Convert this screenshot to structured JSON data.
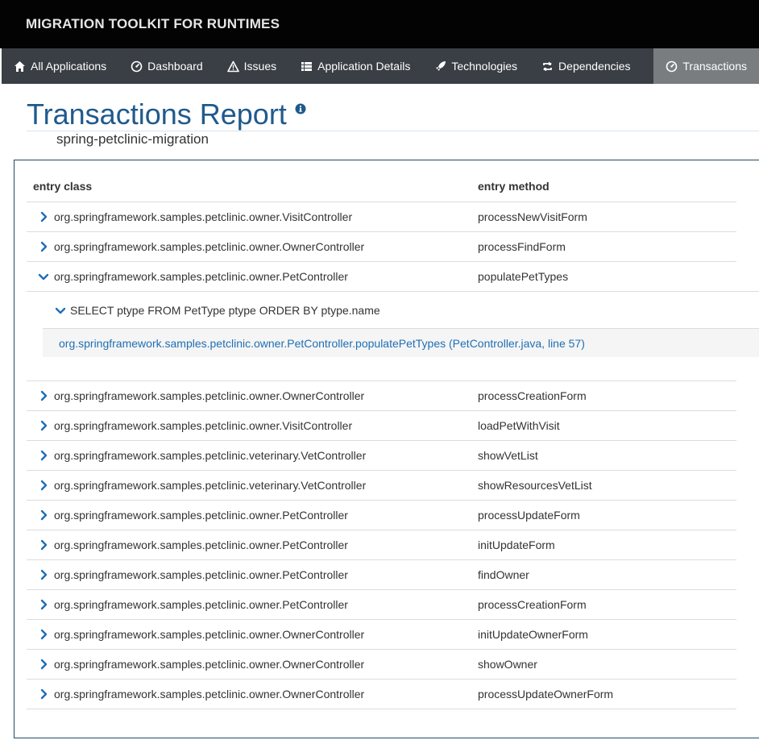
{
  "header": {
    "brand": "MIGRATION TOOLKIT FOR RUNTIMES"
  },
  "nav": {
    "items": [
      {
        "label": "All Applications",
        "icon": "home-icon"
      },
      {
        "label": "Dashboard",
        "icon": "dashboard-icon"
      },
      {
        "label": "Issues",
        "icon": "warning-icon"
      },
      {
        "label": "Application Details",
        "icon": "list-icon"
      },
      {
        "label": "Technologies",
        "icon": "rocket-icon"
      },
      {
        "label": "Dependencies",
        "icon": "retweet-icon"
      },
      {
        "label": "Transactions",
        "icon": "dashboard-icon",
        "active": true
      }
    ]
  },
  "page": {
    "title": "Transactions Report",
    "subtitle": "spring-petclinic-migration"
  },
  "table": {
    "headers": {
      "entry_class": "entry class",
      "entry_method": "entry method"
    },
    "rows": [
      {
        "entry_class": "org.springframework.samples.petclinic.owner.VisitController",
        "entry_method": "processNewVisitForm",
        "expanded": false
      },
      {
        "entry_class": "org.springframework.samples.petclinic.owner.OwnerController",
        "entry_method": "processFindForm",
        "expanded": false
      },
      {
        "entry_class": "org.springframework.samples.petclinic.owner.PetController",
        "entry_method": "populatePetTypes",
        "expanded": true
      },
      {
        "entry_class": "org.springframework.samples.petclinic.owner.OwnerController",
        "entry_method": "processCreationForm",
        "expanded": false
      },
      {
        "entry_class": "org.springframework.samples.petclinic.owner.VisitController",
        "entry_method": "loadPetWithVisit",
        "expanded": false
      },
      {
        "entry_class": "org.springframework.samples.petclinic.veterinary.VetController",
        "entry_method": "showVetList",
        "expanded": false
      },
      {
        "entry_class": "org.springframework.samples.petclinic.veterinary.VetController",
        "entry_method": "showResourcesVetList",
        "expanded": false
      },
      {
        "entry_class": "org.springframework.samples.petclinic.owner.PetController",
        "entry_method": "processUpdateForm",
        "expanded": false
      },
      {
        "entry_class": "org.springframework.samples.petclinic.owner.PetController",
        "entry_method": "initUpdateForm",
        "expanded": false
      },
      {
        "entry_class": "org.springframework.samples.petclinic.owner.PetController",
        "entry_method": "findOwner",
        "expanded": false
      },
      {
        "entry_class": "org.springframework.samples.petclinic.owner.PetController",
        "entry_method": "processCreationForm",
        "expanded": false
      },
      {
        "entry_class": "org.springframework.samples.petclinic.owner.OwnerController",
        "entry_method": "initUpdateOwnerForm",
        "expanded": false
      },
      {
        "entry_class": "org.springframework.samples.petclinic.owner.OwnerController",
        "entry_method": "showOwner",
        "expanded": false
      },
      {
        "entry_class": "org.springframework.samples.petclinic.owner.OwnerController",
        "entry_method": "processUpdateOwnerForm",
        "expanded": false
      }
    ],
    "expanded_detail": {
      "sql": "SELECT ptype FROM PetType ptype ORDER BY ptype.name",
      "stack_trace": "org.springframework.samples.petclinic.owner.PetController.populatePetTypes (PetController.java, line 57)"
    }
  },
  "colors": {
    "title": "#1f5a8d",
    "nav_background": "#393f44",
    "nav_active": "#7a7d80",
    "link": "#1f6fb5",
    "chevron": "#1f6fb5"
  }
}
